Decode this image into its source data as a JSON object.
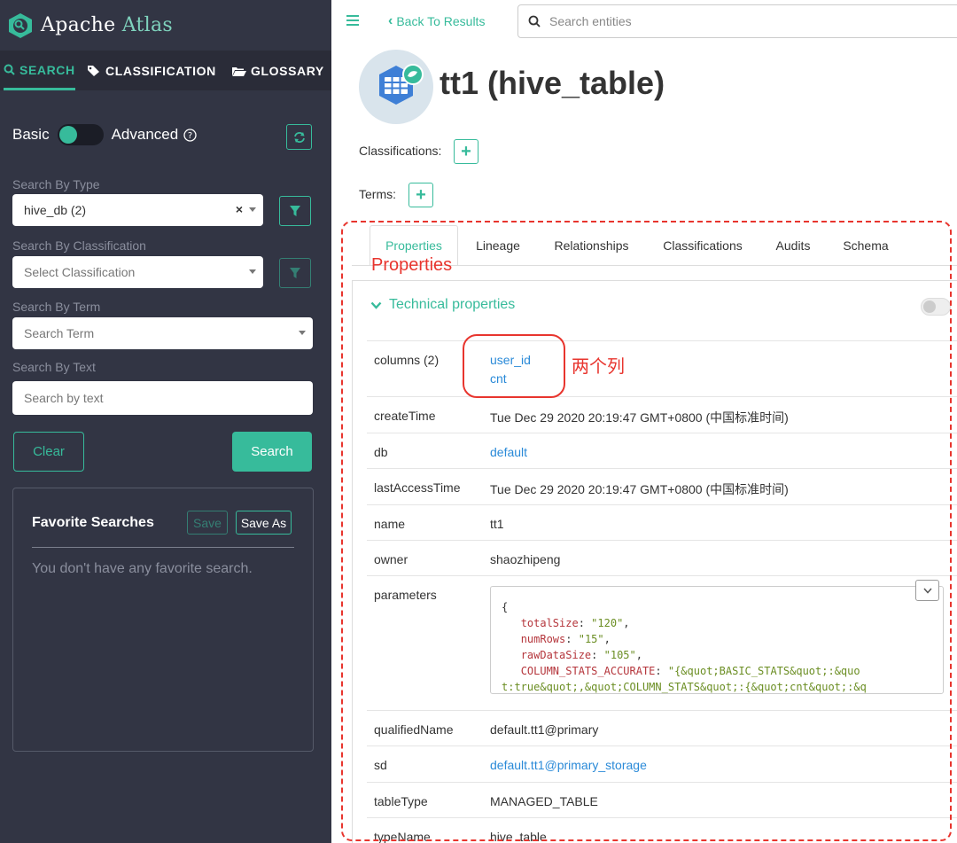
{
  "app": {
    "name_prefix": "Apache",
    "name_suffix": "Atlas"
  },
  "nav_tabs": [
    "SEARCH",
    "CLASSIFICATION",
    "GLOSSARY"
  ],
  "search_mode": {
    "basic_label": "Basic",
    "advanced_label": "Advanced",
    "advanced_enabled": false
  },
  "search_panel": {
    "type_label": "Search By Type",
    "type_value": "hive_db (2)",
    "classification_label": "Search By Classification",
    "classification_placeholder": "Select Classification",
    "term_label": "Search By Term",
    "term_placeholder": "Search Term",
    "text_label": "Search By Text",
    "text_placeholder": "Search by text",
    "clear_label": "Clear",
    "search_label": "Search"
  },
  "favorites": {
    "title": "Favorite Searches",
    "save_label": "Save",
    "save_as_label": "Save As",
    "empty_text": "You don't have any favorite search."
  },
  "topbar": {
    "back_label": "Back To Results",
    "search_placeholder": "Search entities"
  },
  "entity": {
    "title": "tt1 (hive_table)",
    "classifications_label": "Classifications:",
    "terms_label": "Terms:"
  },
  "tabs": [
    "Properties",
    "Lineage",
    "Relationships",
    "Classifications",
    "Audits",
    "Schema"
  ],
  "annotations": {
    "properties_note": "Properties",
    "columns_note": "两个列"
  },
  "technical_properties": {
    "header": "Technical properties",
    "rows": {
      "columns": {
        "key": "columns (2)",
        "values": [
          "user_id",
          "cnt"
        ]
      },
      "createTime": {
        "key": "createTime",
        "value": "Tue Dec 29 2020 20:19:47 GMT+0800 (中国标准时间)"
      },
      "db": {
        "key": "db",
        "value": "default"
      },
      "lastAccessTime": {
        "key": "lastAccessTime",
        "value": "Tue Dec 29 2020 20:19:47 GMT+0800 (中国标准时间)"
      },
      "name": {
        "key": "name",
        "value": "tt1"
      },
      "owner": {
        "key": "owner",
        "value": "shaozhipeng"
      },
      "parameters": {
        "key": "parameters",
        "json": [
          {
            "k": "totalSize",
            "v": "\"120\""
          },
          {
            "k": "numRows",
            "v": "\"15\""
          },
          {
            "k": "rawDataSize",
            "v": "\"105\""
          },
          {
            "k": "COLUMN_STATS_ACCURATE",
            "v": "\"{&quot;BASIC_STATS&quot;:&quo"
          }
        ],
        "json_wrap": "t:true&quot;,&quot;COLUMN_STATS&quot;:{&quot;cnt&quot;:&q"
      },
      "qualifiedName": {
        "key": "qualifiedName",
        "value": "default.tt1@primary"
      },
      "sd": {
        "key": "sd",
        "value": "default.tt1@primary_storage"
      },
      "tableType": {
        "key": "tableType",
        "value": "MANAGED_TABLE"
      },
      "typeName": {
        "key": "typeName",
        "value": "hive_table"
      }
    }
  },
  "colors": {
    "accent": "#37bb9b",
    "sidebar_bg": "#323544",
    "link": "#2a8ad8",
    "annotation": "#e8352e"
  }
}
